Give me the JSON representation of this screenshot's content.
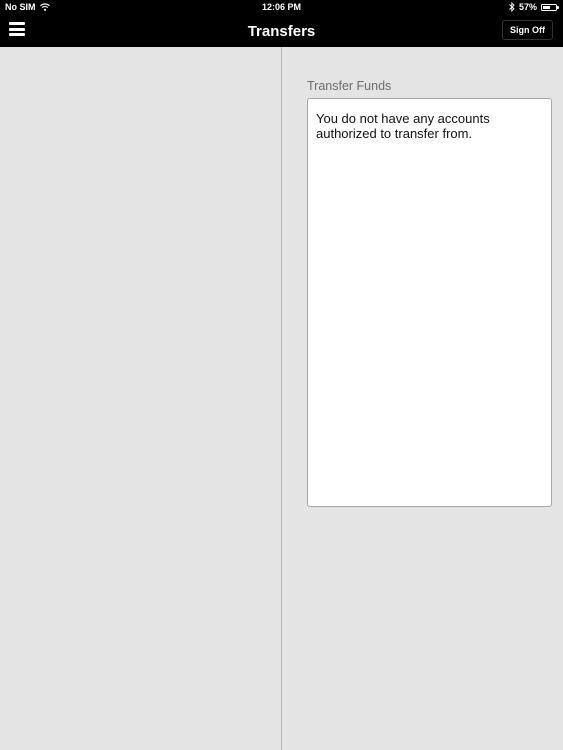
{
  "status_bar": {
    "carrier": "No SIM",
    "time": "12:06 PM",
    "battery_percent": "57%",
    "battery_level": 0.57
  },
  "nav": {
    "title": "Transfers",
    "sign_off_label": "Sign Off"
  },
  "transfer": {
    "section_title": "Transfer Funds",
    "message": "You do not have any accounts authorized to transfer from."
  },
  "colors": {
    "bar_background": "#000000",
    "page_background": "#e4e4e4",
    "section_title": "#6d6d6d"
  }
}
